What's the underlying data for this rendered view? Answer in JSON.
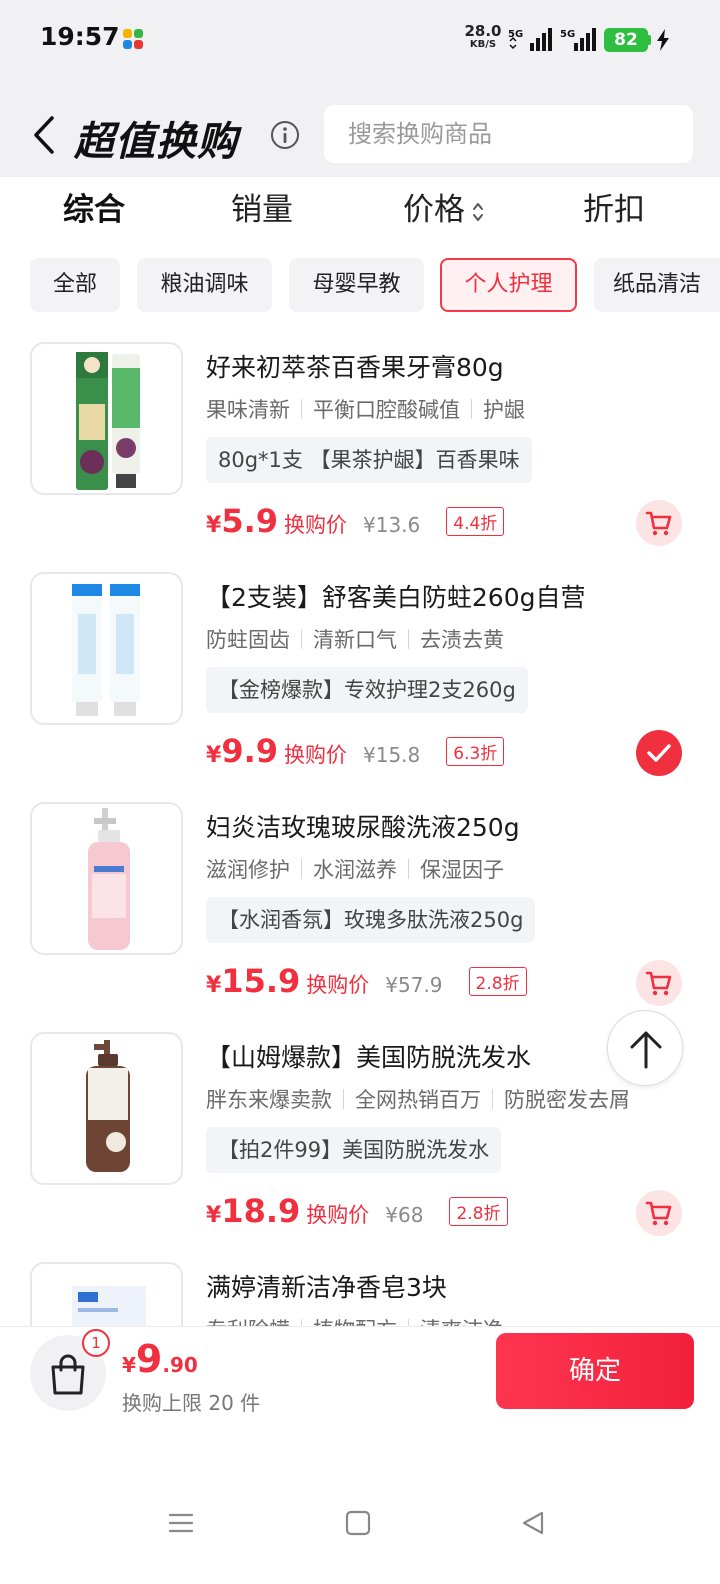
{
  "status_bar": {
    "time": "19:57",
    "net_speed_value": "28.0",
    "net_speed_unit": "KB/S",
    "sim1": "5G",
    "sim2": "5G",
    "battery": "82"
  },
  "header": {
    "title": "超值换购",
    "search_placeholder": "搜索换购商品"
  },
  "sort_tabs": [
    {
      "label": "综合",
      "active": true
    },
    {
      "label": "销量"
    },
    {
      "label": "价格"
    },
    {
      "label": "折扣"
    }
  ],
  "categories": [
    {
      "label": "全部"
    },
    {
      "label": "粮油调味"
    },
    {
      "label": "母婴早教"
    },
    {
      "label": "个人护理",
      "active": true
    },
    {
      "label": "纸品清洁"
    }
  ],
  "products": [
    {
      "title": "好来初萃茶百香果牙膏80g",
      "tags": [
        "果味清新",
        "平衡口腔酸碱值",
        "护龈"
      ],
      "spec": "80g*1支 【果茶护龈】百香果味",
      "price": "5.9",
      "price_label": "换购价",
      "original_price": "¥13.6",
      "discount": "4.4折",
      "selected": false
    },
    {
      "title": "【2支装】舒客美白防蛀260g自营",
      "tags": [
        "防蛀固齿",
        "清新口气",
        "去渍去黄"
      ],
      "spec": "【金榜爆款】专效护理2支260g",
      "price": "9.9",
      "price_label": "换购价",
      "original_price": "¥15.8",
      "discount": "6.3折",
      "selected": true
    },
    {
      "title": "妇炎洁玫瑰玻尿酸洗液250g",
      "tags": [
        "滋润修护",
        "水润滋养",
        "保湿因子"
      ],
      "spec": "【水润香氛】玫瑰多肽洗液250g",
      "price": "15.9",
      "price_label": "换购价",
      "original_price": "¥57.9",
      "discount": "2.8折",
      "selected": false
    },
    {
      "title": "【山姆爆款】美国防脱洗发水",
      "tags": [
        "胖东来爆卖款",
        "全网热销百万",
        "防脱密发去屑"
      ],
      "spec": "【拍2件99】美国防脱洗发水",
      "price": "18.9",
      "price_label": "换购价",
      "original_price": "¥68",
      "discount": "2.8折",
      "selected": false
    },
    {
      "title": "满婷清新洁净香皂3块",
      "tags": [
        "专利除螨",
        "植物配方",
        "清爽洁净"
      ]
    }
  ],
  "bottom": {
    "cart_count": "1",
    "yen": "¥",
    "total_int": "9",
    "total_dec": ".90",
    "limit_text": "换购上限 20 件",
    "confirm_label": "确定"
  },
  "colors": {
    "accent": "#f0303f",
    "chip_active_bg": "#fff1f1",
    "battery": "#2fbe3f"
  }
}
